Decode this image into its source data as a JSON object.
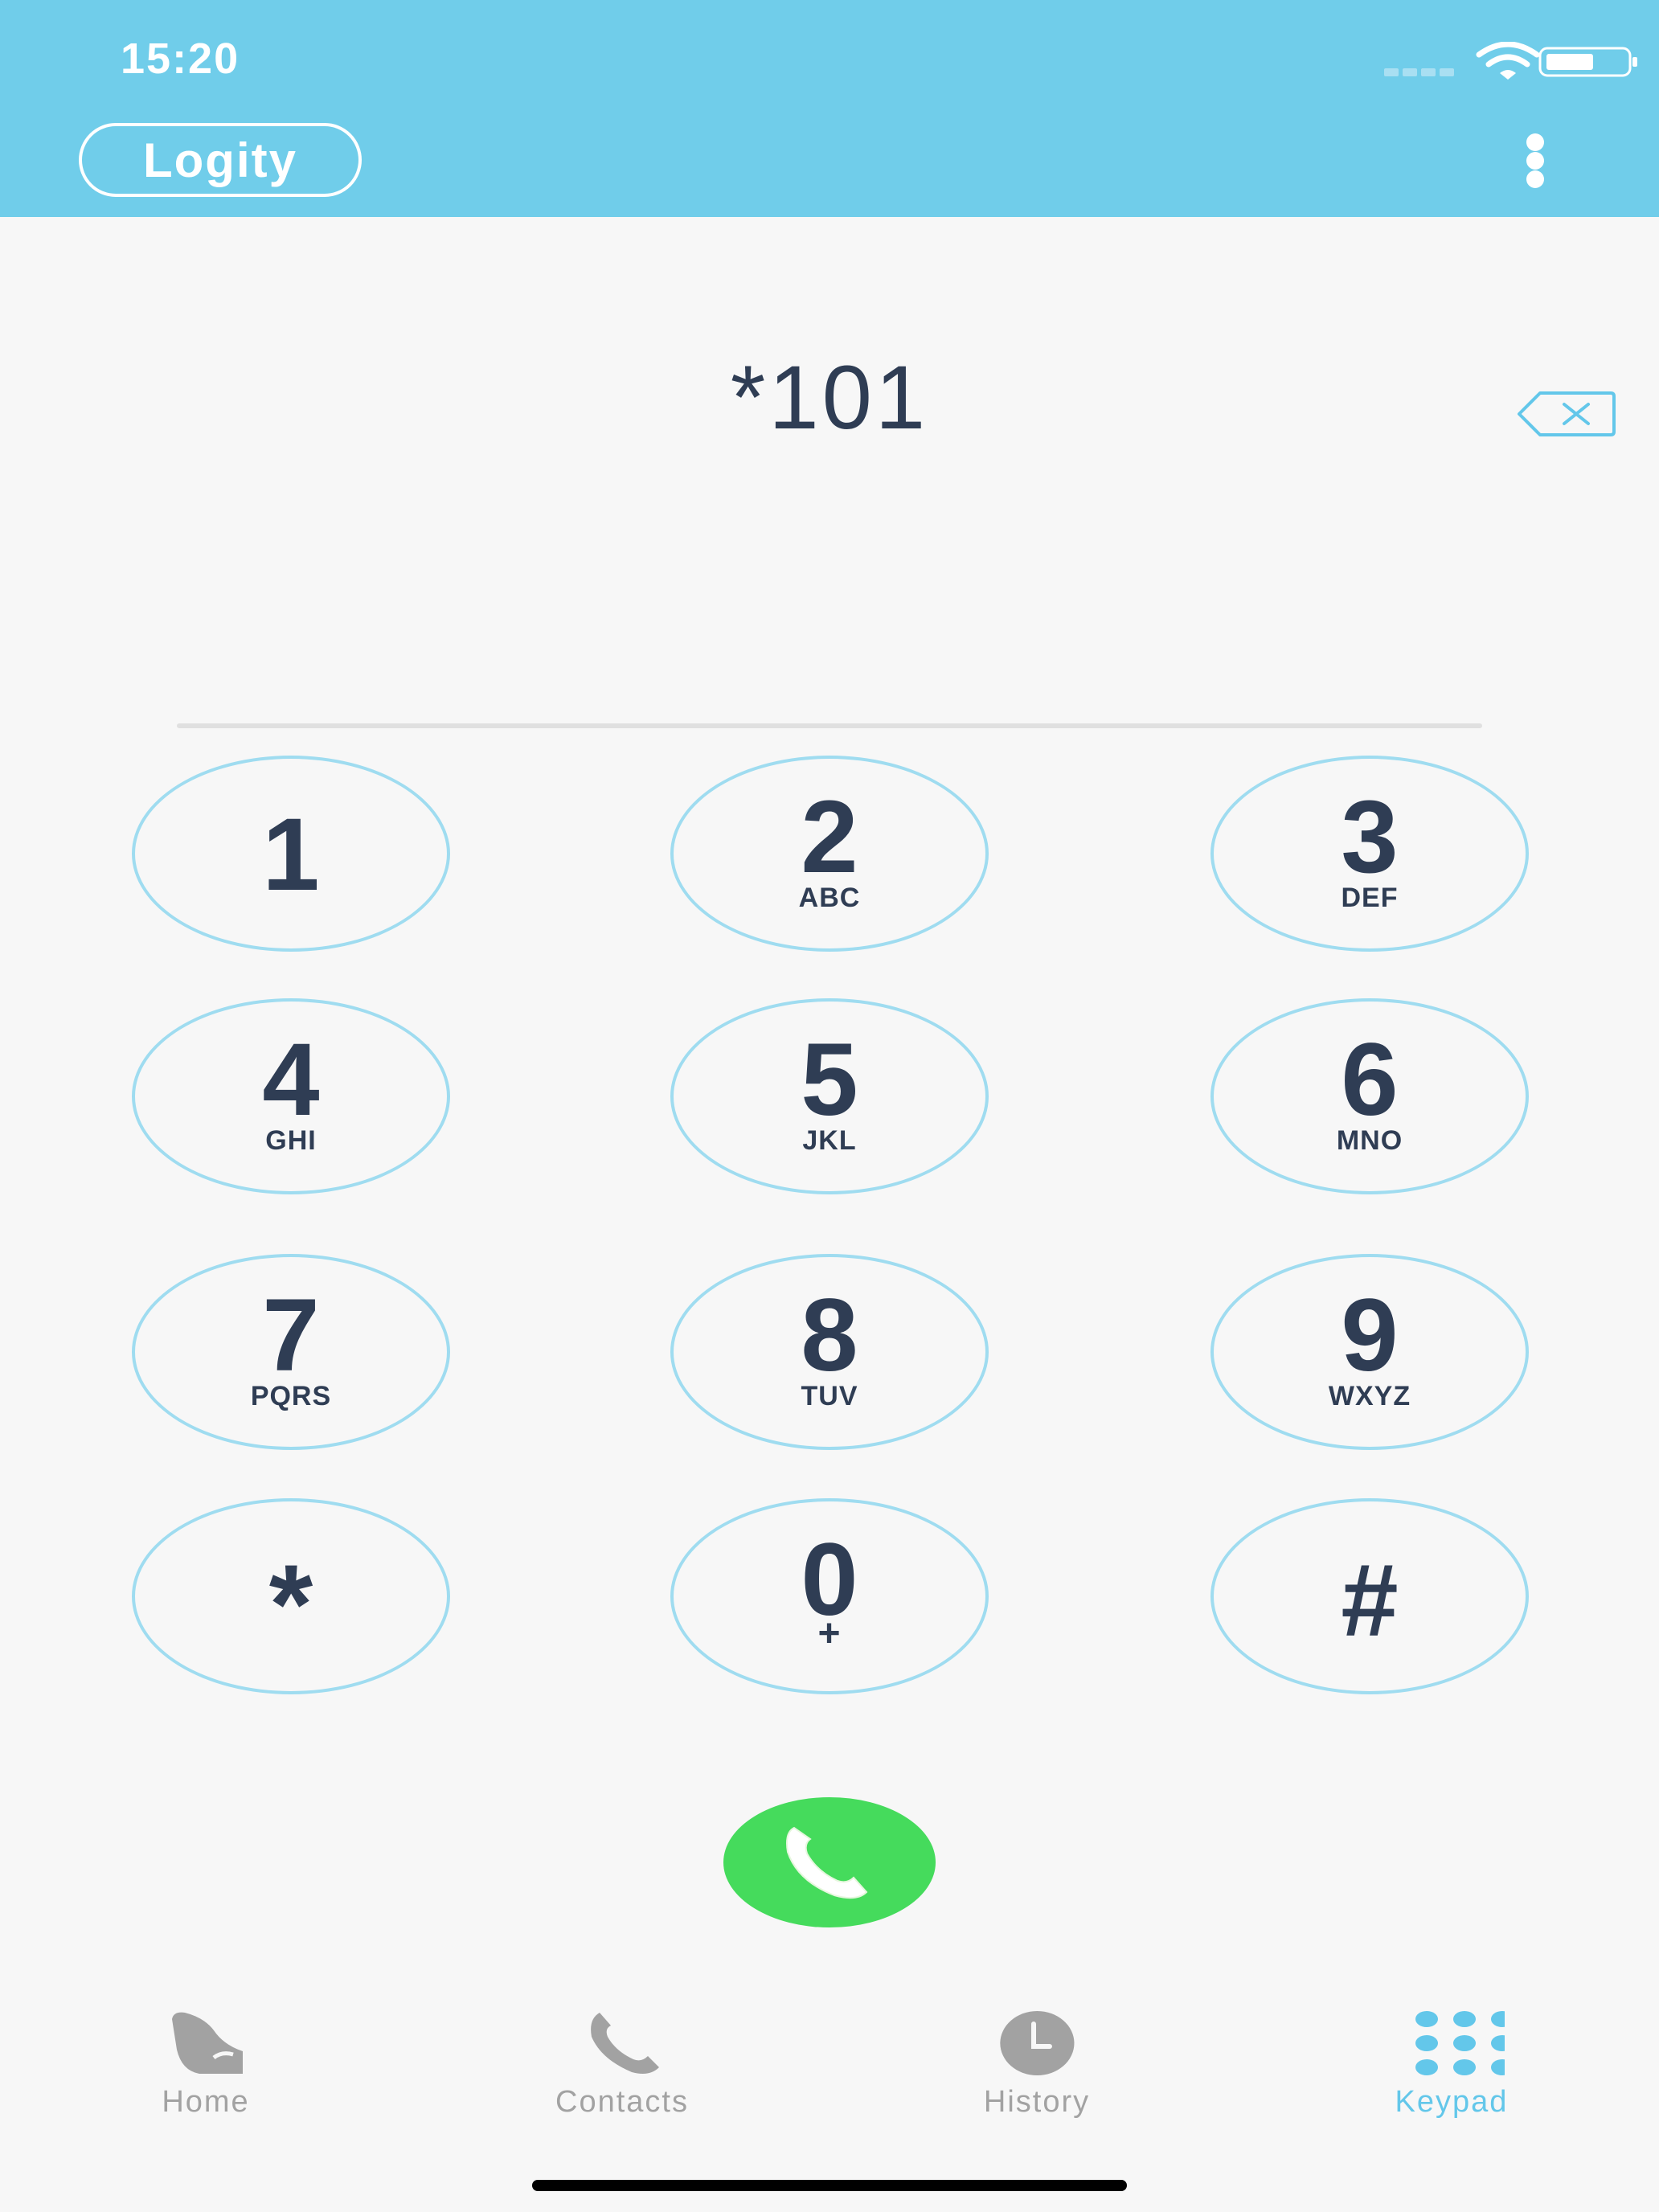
{
  "status_bar": {
    "time": "15:20"
  },
  "header": {
    "brand": "Logity",
    "menu_icon": "more-vertical-icon"
  },
  "dialer": {
    "number": "*101",
    "backspace_icon": "backspace-icon"
  },
  "keypad": {
    "keys": [
      {
        "digit": "1",
        "letters": ""
      },
      {
        "digit": "2",
        "letters": "ABC"
      },
      {
        "digit": "3",
        "letters": "DEF"
      },
      {
        "digit": "4",
        "letters": "GHI"
      },
      {
        "digit": "5",
        "letters": "JKL"
      },
      {
        "digit": "6",
        "letters": "MNO"
      },
      {
        "digit": "7",
        "letters": "PQRS"
      },
      {
        "digit": "8",
        "letters": "TUV"
      },
      {
        "digit": "9",
        "letters": "WXYZ"
      },
      {
        "digit": "*",
        "letters": ""
      },
      {
        "digit": "0",
        "letters": "+"
      },
      {
        "digit": "#",
        "letters": ""
      }
    ]
  },
  "call_button": {
    "icon": "phone-icon",
    "color": "#45db5c"
  },
  "tabs": [
    {
      "label": "Home",
      "icon": "home-icon",
      "active": false
    },
    {
      "label": "Contacts",
      "icon": "contacts-icon",
      "active": false
    },
    {
      "label": "History",
      "icon": "clock-icon",
      "active": false
    },
    {
      "label": "Keypad",
      "icon": "keypad-icon",
      "active": true
    }
  ],
  "colors": {
    "header": "#70cdea",
    "accent": "#63c7ea",
    "text_dark": "#2f3d54",
    "inactive": "#a2a2a2"
  }
}
